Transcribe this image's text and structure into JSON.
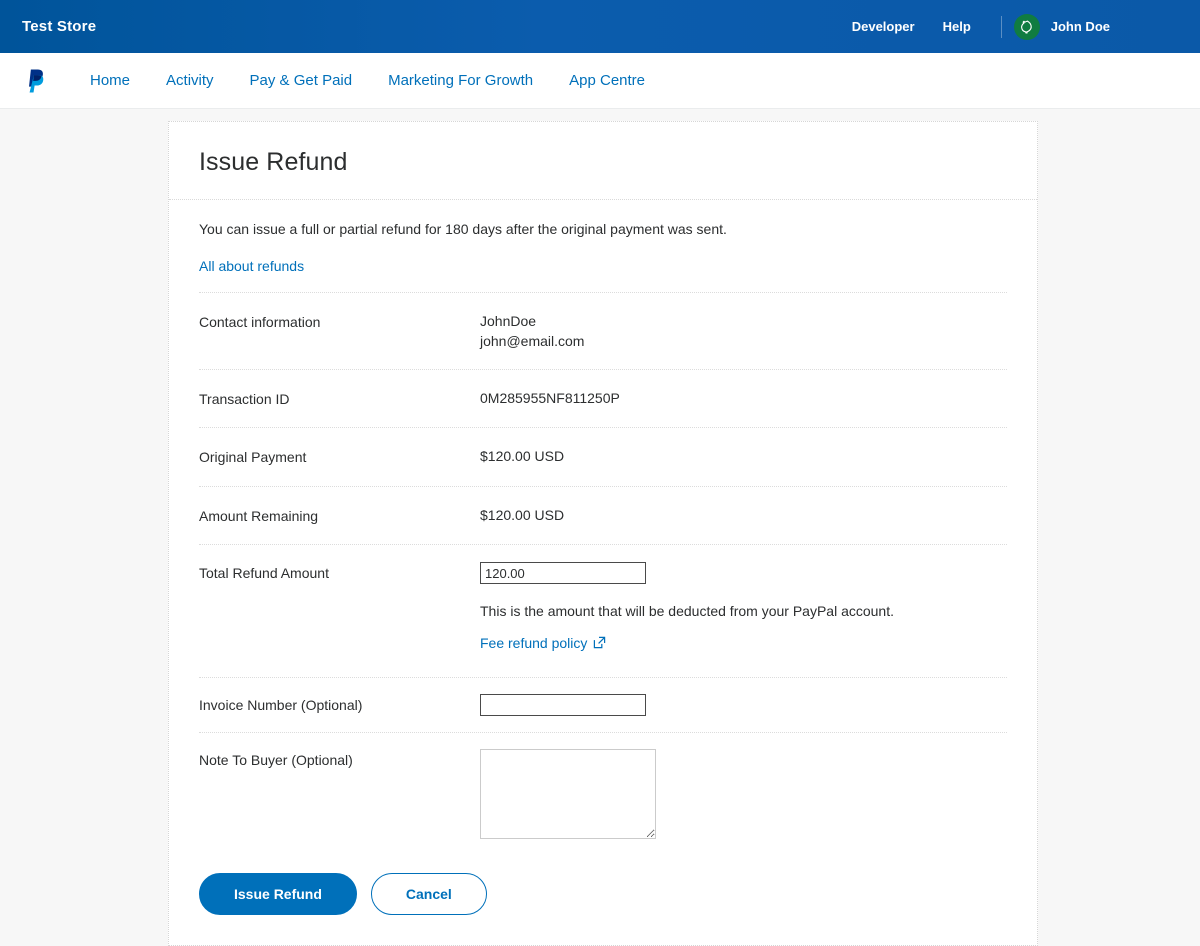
{
  "topbar": {
    "store_name": "Test Store",
    "links": [
      {
        "label": "Developer"
      },
      {
        "label": "Help"
      }
    ],
    "user": {
      "name": "John Doe",
      "avatar_icon": "leaf-icon",
      "avatar_color": "#107c41"
    },
    "background_color": "#0a57a5"
  },
  "nav": {
    "logo_icon": "paypal-logo-icon",
    "items": [
      {
        "label": "Home"
      },
      {
        "label": "Activity"
      },
      {
        "label": "Pay & Get Paid"
      },
      {
        "label": "Marketing For Growth"
      },
      {
        "label": "App Centre"
      }
    ],
    "link_color": "#0070ba"
  },
  "card": {
    "title": "Issue Refund",
    "intro_text": "You can issue a full or partial refund for 180 days after the original payment was sent.",
    "intro_link": "All about refunds"
  },
  "details": {
    "contact": {
      "label": "Contact information",
      "name": "JohnDoe",
      "email": "john@email.com"
    },
    "transaction": {
      "label": "Transaction ID",
      "value": "0M285955NF811250P"
    },
    "original_payment": {
      "label": "Original Payment",
      "value": "$120.00 USD"
    },
    "amount_remaining": {
      "label": "Amount Remaining",
      "value": "$120.00 USD"
    }
  },
  "form": {
    "refund_amount": {
      "label": "Total Refund Amount",
      "value": "120.00",
      "placeholder": "",
      "helper_text": "This is the amount that will be deducted from your PayPal account.",
      "policy_link": "Fee refund policy",
      "policy_link_icon": "external-link-icon"
    },
    "invoice_number": {
      "label": "Invoice Number (Optional)",
      "value": "",
      "placeholder": ""
    },
    "note_to_buyer": {
      "label": "Note To Buyer (Optional)",
      "value": "",
      "placeholder": ""
    }
  },
  "actions": {
    "submit_label": "Issue Refund",
    "cancel_label": "Cancel",
    "primary_color": "#0070ba"
  }
}
